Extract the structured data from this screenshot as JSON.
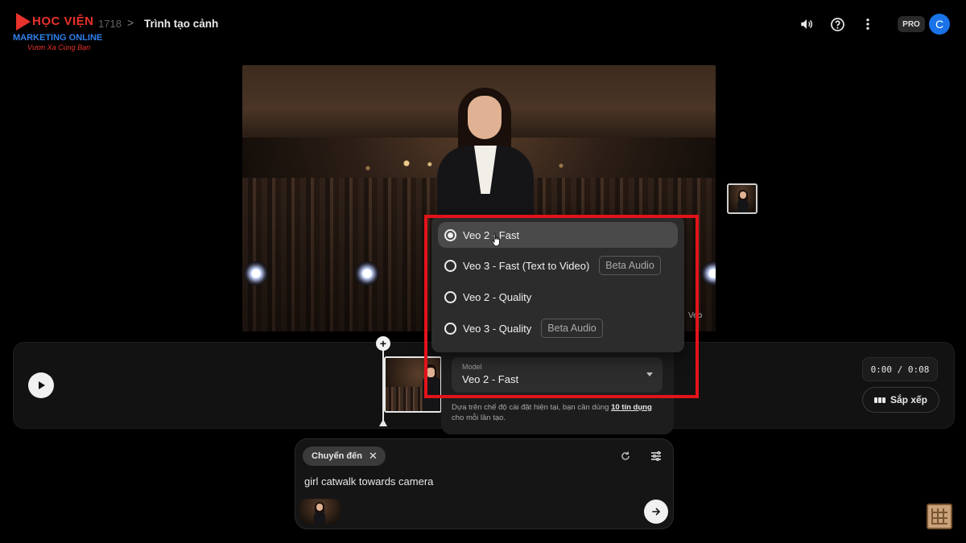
{
  "header": {
    "logo_line1": "HỌC VIỆN",
    "logo_line2": "MARKETING ONLINE",
    "logo_tagline": "Vươn Xa Cùng Bạn",
    "breadcrumb_project": "1718",
    "breadcrumb_chevron": ">",
    "page_title": "Trình tạo cảnh",
    "icons": [
      "volume-icon",
      "help-icon",
      "more-vert-icon"
    ],
    "plan_badge": "PRO",
    "avatar_letter": "C"
  },
  "preview": {
    "watermark": "Veo"
  },
  "model_menu": {
    "options": [
      {
        "label": "Veo 2 - Fast",
        "selected": true,
        "tag": ""
      },
      {
        "label": "Veo 3 - Fast (Text to Video)",
        "selected": false,
        "tag": "Beta Audio"
      },
      {
        "label": "Veo 2 - Quality",
        "selected": false,
        "tag": ""
      },
      {
        "label": "Veo 3 - Quality",
        "selected": false,
        "tag": "Beta Audio"
      }
    ],
    "highlight_color": "#e3131a"
  },
  "model_select": {
    "caption": "Model",
    "value": "Veo 2 - Fast",
    "note_before": "Dựa trên chế độ cài đặt hiện tại, bạn cần dùng ",
    "note_link": "10 tín dụng",
    "note_after": " cho mỗi lần tạo."
  },
  "timeline": {
    "time_display": "0:00 / 0:08",
    "arrange_label": "Sắp xếp"
  },
  "prompt": {
    "chip_label": "Chuyển đến",
    "text": "girl catwalk towards camera"
  },
  "colors": {
    "accent_blue": "#1a73e8",
    "logo_red": "#e8322b"
  }
}
